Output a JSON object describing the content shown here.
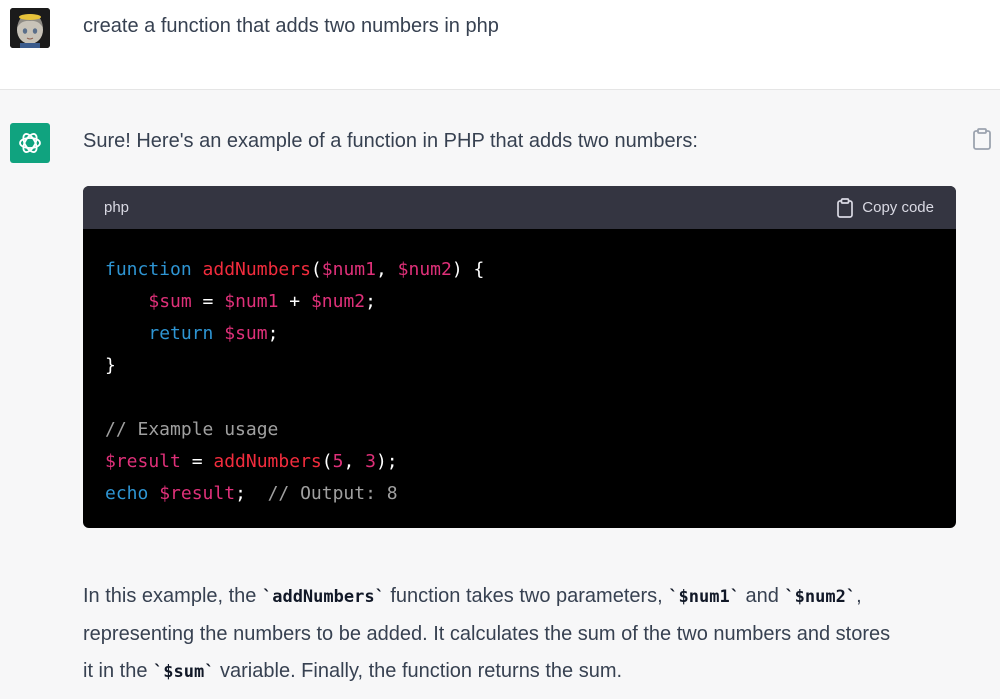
{
  "user_message": {
    "text": "create a function that adds two numbers in php"
  },
  "assistant": {
    "intro": "Sure! Here's an example of a function in PHP that adds two numbers:",
    "code": {
      "language": "php",
      "copy_label": "Copy code",
      "lines": [
        [
          [
            "kw",
            "function"
          ],
          [
            "pn",
            " "
          ],
          [
            "fn",
            "addNumbers"
          ],
          [
            "pn",
            "("
          ],
          [
            "var",
            "$num1"
          ],
          [
            "pn",
            ", "
          ],
          [
            "var",
            "$num2"
          ],
          [
            "pn",
            ") {"
          ]
        ],
        [
          [
            "pn",
            "    "
          ],
          [
            "var",
            "$sum"
          ],
          [
            "pn",
            " = "
          ],
          [
            "var",
            "$num1"
          ],
          [
            "pn",
            " + "
          ],
          [
            "var",
            "$num2"
          ],
          [
            "pn",
            ";"
          ]
        ],
        [
          [
            "pn",
            "    "
          ],
          [
            "kw",
            "return"
          ],
          [
            "pn",
            " "
          ],
          [
            "var",
            "$sum"
          ],
          [
            "pn",
            ";"
          ]
        ],
        [
          [
            "pn",
            "}"
          ]
        ],
        [
          [
            "pn",
            ""
          ]
        ],
        [
          [
            "cm",
            "// Example usage"
          ]
        ],
        [
          [
            "var",
            "$result"
          ],
          [
            "pn",
            " = "
          ],
          [
            "fn",
            "addNumbers"
          ],
          [
            "pn",
            "("
          ],
          [
            "num",
            "5"
          ],
          [
            "pn",
            ", "
          ],
          [
            "num",
            "3"
          ],
          [
            "pn",
            ");"
          ]
        ],
        [
          [
            "kw",
            "echo"
          ],
          [
            "pn",
            " "
          ],
          [
            "var",
            "$result"
          ],
          [
            "pn",
            ";  "
          ],
          [
            "cm",
            "// Output: 8"
          ]
        ]
      ]
    },
    "explanation": {
      "p1": "In this example, the ",
      "c1": "`addNumbers`",
      "p2": " function takes two parameters, ",
      "c2": "`$num1`",
      "p3": " and ",
      "c3": "`$num2`",
      "p4": ",",
      "p5": "representing the numbers to be added. It calculates the sum of the two numbers and stores",
      "p6": "it in the ",
      "c4": "`$sum`",
      "p7": " variable. Finally, the function returns the sum."
    }
  },
  "colors": {
    "bot_avatar": "#10a37f",
    "code_bg": "#000000",
    "code_header_bg": "#343541",
    "keyword": "#2e95d3",
    "function_name": "#f22c3d",
    "variable": "#df3079",
    "comment": "#a0a0a0"
  },
  "icons": {
    "user_avatar": "anime-avatar-icon",
    "bot_avatar": "openai-logo-icon",
    "copy": "clipboard-icon"
  }
}
